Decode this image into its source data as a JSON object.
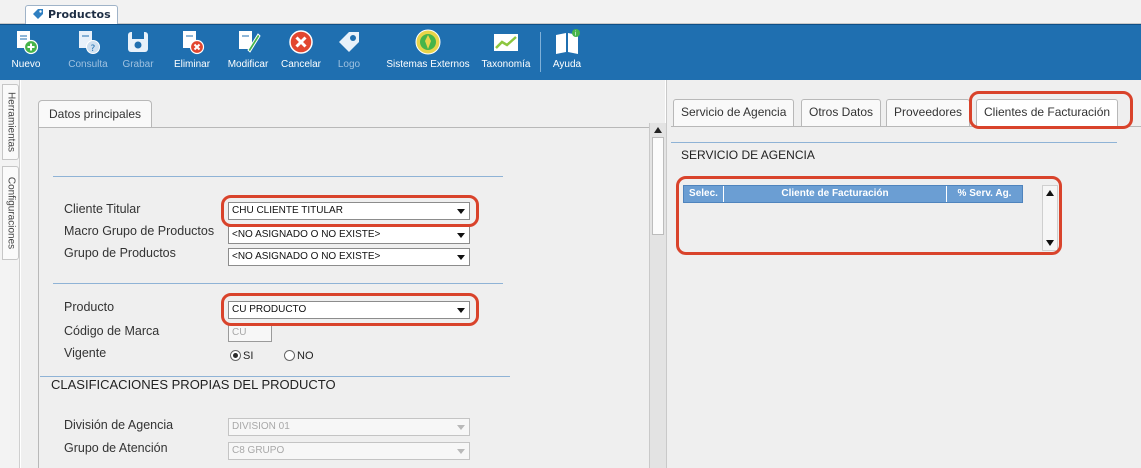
{
  "window_tab": {
    "title": "Productos"
  },
  "toolbar": {
    "buttons": [
      {
        "label": "Nuevo",
        "enabled": true
      },
      {
        "label": "Consulta",
        "enabled": false
      },
      {
        "label": "Grabar",
        "enabled": false
      },
      {
        "label": "Eliminar",
        "enabled": true
      },
      {
        "label": "Modificar",
        "enabled": true
      },
      {
        "label": "Cancelar",
        "enabled": true
      },
      {
        "label": "Logo",
        "enabled": false
      },
      {
        "label": "Sistemas Externos",
        "enabled": true
      },
      {
        "label": "Taxonomía",
        "enabled": true
      },
      {
        "label": "Ayuda",
        "enabled": true
      }
    ],
    "colors": {
      "background": "#1f6fb0",
      "text": "#ffffff",
      "disabled_text": "#9fc1e0"
    }
  },
  "side_tabs": [
    "Herramientas",
    "Configuraciones"
  ],
  "left_panel": {
    "tab": "Datos principales",
    "fields": {
      "cliente_titular": {
        "label": "Cliente Titular",
        "value": "CHU CLIENTE TITULAR"
      },
      "macro_grupo": {
        "label": "Macro Grupo de Productos",
        "value": "<NO ASIGNADO O NO EXISTE>"
      },
      "grupo_productos": {
        "label": "Grupo de Productos",
        "value": "<NO ASIGNADO O NO EXISTE>"
      },
      "producto": {
        "label": "Producto",
        "value": "CU PRODUCTO"
      },
      "codigo_marca": {
        "label": "Código de Marca",
        "value": "CU"
      },
      "vigente": {
        "label": "Vigente",
        "options": [
          "SI",
          "NO"
        ],
        "selected": "SI"
      }
    },
    "section_clasificaciones": {
      "title": "CLASIFICACIONES PROPIAS DEL PRODUCTO",
      "division": {
        "label": "División de Agencia",
        "value": "DIVISION 01"
      },
      "grupo_atencion": {
        "label": "Grupo de Atención",
        "value": "C8 GRUPO"
      }
    }
  },
  "right_panel": {
    "tabs": [
      "Servicio de Agencia",
      "Otros Datos",
      "Proveedores",
      "Clientes de Facturación"
    ],
    "active_tab": "Clientes de Facturación",
    "section_title": "SERVICIO DE AGENCIA",
    "grid": {
      "columns": [
        "Selec.",
        "Cliente de Facturación",
        "% Serv. Ag."
      ],
      "rows": []
    }
  },
  "highlight_color": "#d9432b"
}
